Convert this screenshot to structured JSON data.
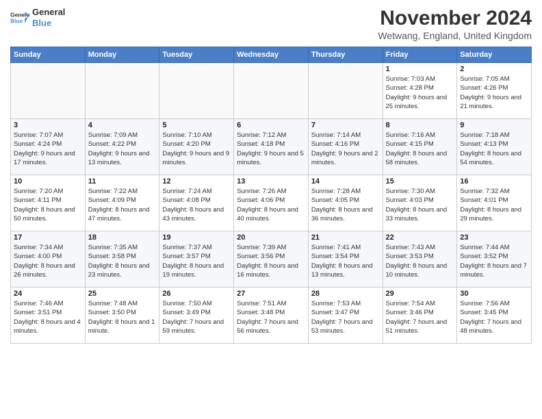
{
  "logo": {
    "line1": "General",
    "line2": "Blue"
  },
  "title": "November 2024",
  "location": "Wetwang, England, United Kingdom",
  "days_of_week": [
    "Sunday",
    "Monday",
    "Tuesday",
    "Wednesday",
    "Thursday",
    "Friday",
    "Saturday"
  ],
  "weeks": [
    [
      {
        "day": null
      },
      {
        "day": null
      },
      {
        "day": null
      },
      {
        "day": null
      },
      {
        "day": null
      },
      {
        "day": "1",
        "sunrise": "Sunrise: 7:03 AM",
        "sunset": "Sunset: 4:28 PM",
        "daylight": "Daylight: 9 hours and 25 minutes."
      },
      {
        "day": "2",
        "sunrise": "Sunrise: 7:05 AM",
        "sunset": "Sunset: 4:26 PM",
        "daylight": "Daylight: 9 hours and 21 minutes."
      }
    ],
    [
      {
        "day": "3",
        "sunrise": "Sunrise: 7:07 AM",
        "sunset": "Sunset: 4:24 PM",
        "daylight": "Daylight: 9 hours and 17 minutes."
      },
      {
        "day": "4",
        "sunrise": "Sunrise: 7:09 AM",
        "sunset": "Sunset: 4:22 PM",
        "daylight": "Daylight: 9 hours and 13 minutes."
      },
      {
        "day": "5",
        "sunrise": "Sunrise: 7:10 AM",
        "sunset": "Sunset: 4:20 PM",
        "daylight": "Daylight: 9 hours and 9 minutes."
      },
      {
        "day": "6",
        "sunrise": "Sunrise: 7:12 AM",
        "sunset": "Sunset: 4:18 PM",
        "daylight": "Daylight: 9 hours and 5 minutes."
      },
      {
        "day": "7",
        "sunrise": "Sunrise: 7:14 AM",
        "sunset": "Sunset: 4:16 PM",
        "daylight": "Daylight: 9 hours and 2 minutes."
      },
      {
        "day": "8",
        "sunrise": "Sunrise: 7:16 AM",
        "sunset": "Sunset: 4:15 PM",
        "daylight": "Daylight: 8 hours and 58 minutes."
      },
      {
        "day": "9",
        "sunrise": "Sunrise: 7:18 AM",
        "sunset": "Sunset: 4:13 PM",
        "daylight": "Daylight: 8 hours and 54 minutes."
      }
    ],
    [
      {
        "day": "10",
        "sunrise": "Sunrise: 7:20 AM",
        "sunset": "Sunset: 4:11 PM",
        "daylight": "Daylight: 8 hours and 50 minutes."
      },
      {
        "day": "11",
        "sunrise": "Sunrise: 7:22 AM",
        "sunset": "Sunset: 4:09 PM",
        "daylight": "Daylight: 8 hours and 47 minutes."
      },
      {
        "day": "12",
        "sunrise": "Sunrise: 7:24 AM",
        "sunset": "Sunset: 4:08 PM",
        "daylight": "Daylight: 8 hours and 43 minutes."
      },
      {
        "day": "13",
        "sunrise": "Sunrise: 7:26 AM",
        "sunset": "Sunset: 4:06 PM",
        "daylight": "Daylight: 8 hours and 40 minutes."
      },
      {
        "day": "14",
        "sunrise": "Sunrise: 7:28 AM",
        "sunset": "Sunset: 4:05 PM",
        "daylight": "Daylight: 8 hours and 36 minutes."
      },
      {
        "day": "15",
        "sunrise": "Sunrise: 7:30 AM",
        "sunset": "Sunset: 4:03 PM",
        "daylight": "Daylight: 8 hours and 33 minutes."
      },
      {
        "day": "16",
        "sunrise": "Sunrise: 7:32 AM",
        "sunset": "Sunset: 4:01 PM",
        "daylight": "Daylight: 8 hours and 29 minutes."
      }
    ],
    [
      {
        "day": "17",
        "sunrise": "Sunrise: 7:34 AM",
        "sunset": "Sunset: 4:00 PM",
        "daylight": "Daylight: 8 hours and 26 minutes."
      },
      {
        "day": "18",
        "sunrise": "Sunrise: 7:35 AM",
        "sunset": "Sunset: 3:58 PM",
        "daylight": "Daylight: 8 hours and 23 minutes."
      },
      {
        "day": "19",
        "sunrise": "Sunrise: 7:37 AM",
        "sunset": "Sunset: 3:57 PM",
        "daylight": "Daylight: 8 hours and 19 minutes."
      },
      {
        "day": "20",
        "sunrise": "Sunrise: 7:39 AM",
        "sunset": "Sunset: 3:56 PM",
        "daylight": "Daylight: 8 hours and 16 minutes."
      },
      {
        "day": "21",
        "sunrise": "Sunrise: 7:41 AM",
        "sunset": "Sunset: 3:54 PM",
        "daylight": "Daylight: 8 hours and 13 minutes."
      },
      {
        "day": "22",
        "sunrise": "Sunrise: 7:43 AM",
        "sunset": "Sunset: 3:53 PM",
        "daylight": "Daylight: 8 hours and 10 minutes."
      },
      {
        "day": "23",
        "sunrise": "Sunrise: 7:44 AM",
        "sunset": "Sunset: 3:52 PM",
        "daylight": "Daylight: 8 hours and 7 minutes."
      }
    ],
    [
      {
        "day": "24",
        "sunrise": "Sunrise: 7:46 AM",
        "sunset": "Sunset: 3:51 PM",
        "daylight": "Daylight: 8 hours and 4 minutes."
      },
      {
        "day": "25",
        "sunrise": "Sunrise: 7:48 AM",
        "sunset": "Sunset: 3:50 PM",
        "daylight": "Daylight: 8 hours and 1 minute."
      },
      {
        "day": "26",
        "sunrise": "Sunrise: 7:50 AM",
        "sunset": "Sunset: 3:49 PM",
        "daylight": "Daylight: 7 hours and 59 minutes."
      },
      {
        "day": "27",
        "sunrise": "Sunrise: 7:51 AM",
        "sunset": "Sunset: 3:48 PM",
        "daylight": "Daylight: 7 hours and 56 minutes."
      },
      {
        "day": "28",
        "sunrise": "Sunrise: 7:53 AM",
        "sunset": "Sunset: 3:47 PM",
        "daylight": "Daylight: 7 hours and 53 minutes."
      },
      {
        "day": "29",
        "sunrise": "Sunrise: 7:54 AM",
        "sunset": "Sunset: 3:46 PM",
        "daylight": "Daylight: 7 hours and 51 minutes."
      },
      {
        "day": "30",
        "sunrise": "Sunrise: 7:56 AM",
        "sunset": "Sunset: 3:45 PM",
        "daylight": "Daylight: 7 hours and 48 minutes."
      }
    ]
  ]
}
